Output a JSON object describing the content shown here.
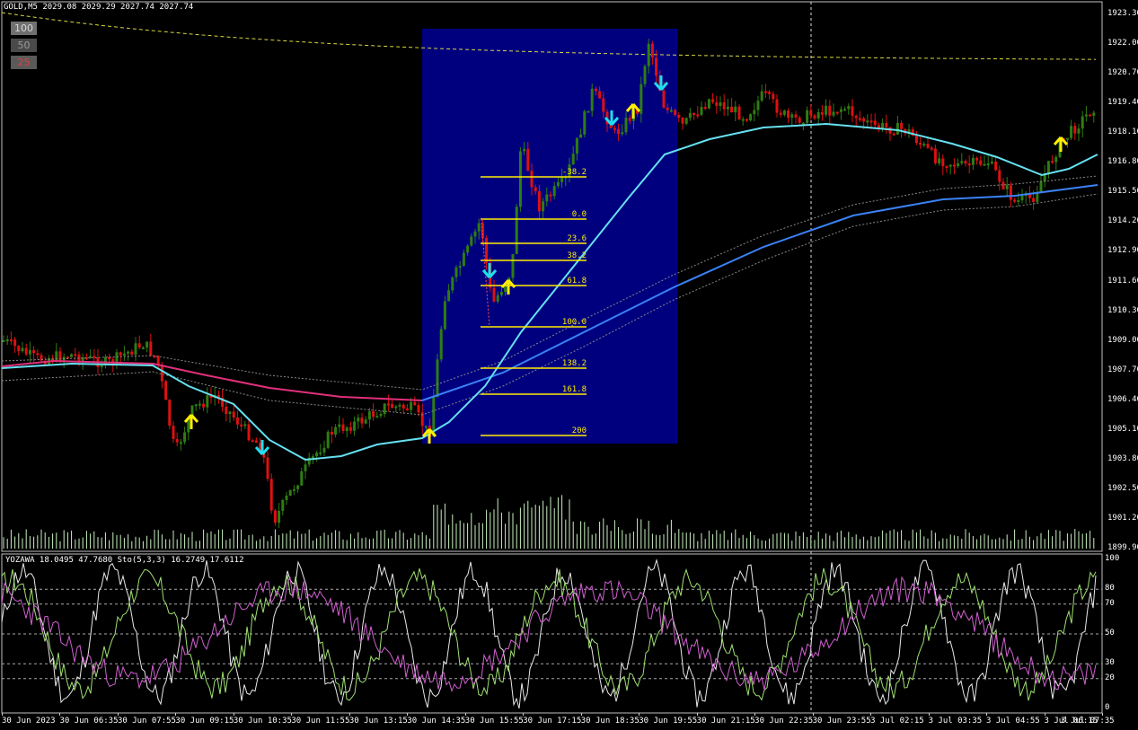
{
  "header": {
    "symbol_line": "GOLD,M5  2029.08 2029.29 2027.74 2027.74",
    "indicator_line": "YOZAWA 18.0495 47.7680  Sto(5,3,3) 16.2749 17.6112"
  },
  "zoom_buttons": [
    "100",
    "50",
    "25"
  ],
  "price_axis": [
    "1923.30",
    "1922.00",
    "1920.70",
    "1919.40",
    "1918.10",
    "1916.80",
    "1915.50",
    "1914.20",
    "1912.90",
    "1911.60",
    "1910.30",
    "1909.00",
    "1907.70",
    "1906.40",
    "1905.10",
    "1903.80",
    "1902.50",
    "1901.20",
    "1899.90"
  ],
  "oscillator_axis": [
    "100",
    "80",
    "70",
    "50",
    "30",
    "20",
    "0"
  ],
  "time_axis": [
    "30 Jun 2023",
    "30 Jun 06:35",
    "30 Jun 07:55",
    "30 Jun 09:15",
    "30 Jun 10:35",
    "30 Jun 11:55",
    "30 Jun 13:15",
    "30 Jun 14:35",
    "30 Jun 15:55",
    "30 Jun 17:15",
    "30 Jun 18:35",
    "30 Jun 19:55",
    "30 Jun 21:15",
    "30 Jun 22:35",
    "30 Jun 23:55",
    "3 Jul 02:15",
    "3 Jul 03:35",
    "3 Jul 04:55",
    "3 Jul 06:15",
    "3 Jul 07:35"
  ],
  "fibonacci_levels": [
    "-38.2",
    "0.0",
    "23.6",
    "38.2",
    "61.8",
    "100.0",
    "138.2",
    "161.8",
    "200"
  ],
  "colors": {
    "background": "#000000",
    "bull_candle": "#2e7d12",
    "bear_candle": "#dd1111",
    "fib_box": "#00007f",
    "fib_line": "#ffee00",
    "ma_fast": "#66e0f0",
    "ma_slow": "#3b82f6",
    "ma_pink": "#e0307a",
    "volume": "#c8f0c0",
    "arrow_up": "#ffee00",
    "arrow_down": "#22ddee"
  }
}
